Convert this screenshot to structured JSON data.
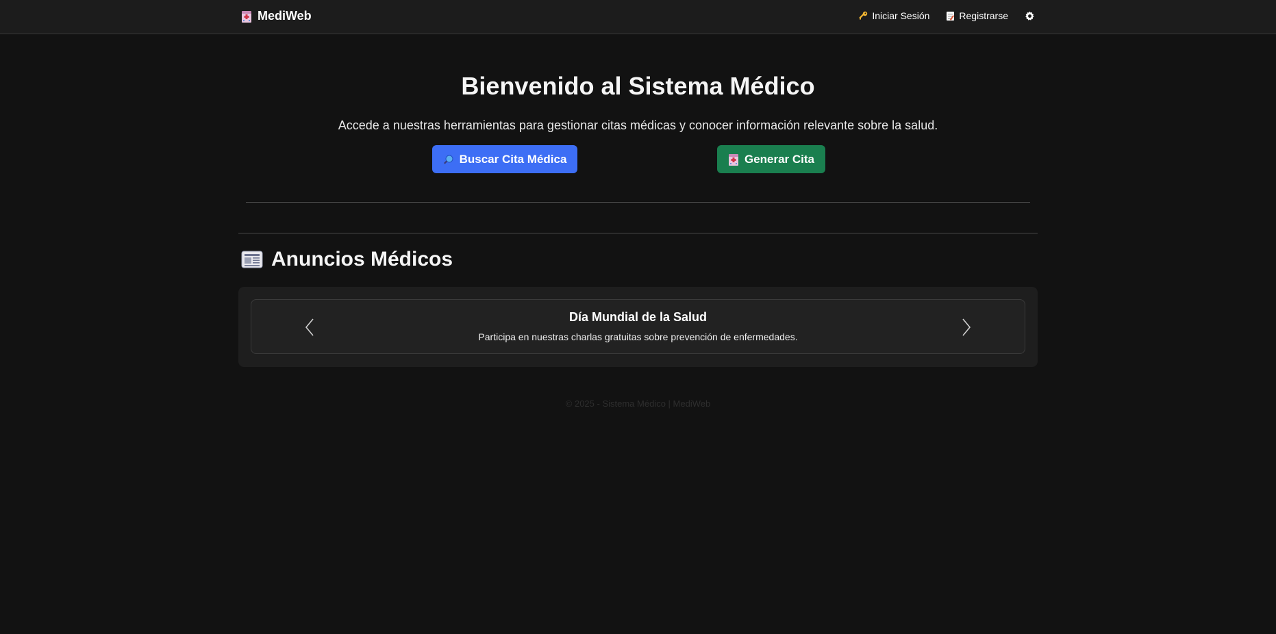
{
  "navbar": {
    "brand_icon": "hospital-icon",
    "brand": "MediWeb",
    "login_icon": "key-icon",
    "login": "Iniciar Sesión",
    "register_icon": "memo-icon",
    "register": "Registrarse",
    "theme_icon": "gear-icon"
  },
  "hero": {
    "title": "Bienvenido al Sistema Médico",
    "subtitle": "Accede a nuestras herramientas para gestionar citas médicas y conocer información relevante sobre la salud.",
    "search_button": {
      "icon": "magnifier-icon",
      "label": "Buscar Cita Médica"
    },
    "generate_button": {
      "icon": "hospital-icon",
      "label": "Generar Cita"
    }
  },
  "announcements": {
    "icon": "newspaper-icon",
    "title": "Anuncios Médicos",
    "items": [
      {
        "title": "Día Mundial de la Salud",
        "text": "Participa en nuestras charlas gratuitas sobre prevención de enfermedades."
      }
    ]
  },
  "footer": {
    "text": "© 2025 - Sistema Médico | MediWeb"
  },
  "colors": {
    "background": "#121212",
    "navbar": "#1c1c1c",
    "primary_button": "#3d6ef5",
    "success_button": "#1a7f4f",
    "card": "#1e1e1e"
  }
}
